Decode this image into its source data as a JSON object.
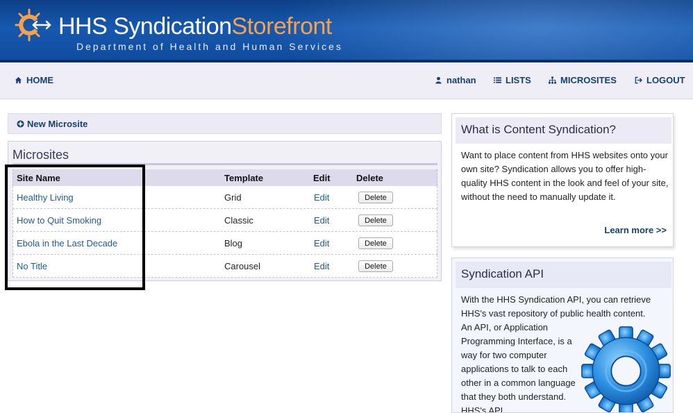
{
  "header": {
    "brand_hhs": "HHS",
    "brand_syndication": "Syndication",
    "brand_storefront": "Storefront",
    "subtitle": "Department of Health and Human Services"
  },
  "nav": {
    "home": "HOME",
    "user": "nathan",
    "lists": "LISTS",
    "microsites": "MICROSITES",
    "logout": "LOGOUT"
  },
  "new_microsite": "New Microsite",
  "microsites": {
    "title": "Microsites",
    "columns": [
      "Site Name",
      "Template",
      "Edit",
      "Delete"
    ],
    "rows": [
      {
        "site": "Healthy Living",
        "template": "Grid",
        "edit": "Edit",
        "delete": "Delete"
      },
      {
        "site": "How to Quit Smoking",
        "template": "Classic",
        "edit": "Edit",
        "delete": "Delete"
      },
      {
        "site": "Ebola in the Last Decade",
        "template": "Blog",
        "edit": "Edit",
        "delete": "Delete"
      },
      {
        "site": "No Title",
        "template": "Carousel",
        "edit": "Edit",
        "delete": "Delete"
      }
    ]
  },
  "syndication_box": {
    "title": "What is Content Syndication?",
    "body": "Want to place content from HHS websites onto your own site? Syndication allows you to offer high-quality HHS content in the look and feel of your site, without the need to manually update it.",
    "learn_more": "Learn more >>"
  },
  "api_box": {
    "title": "Syndication API",
    "body_full": "With the HHS Syndication API, you can retrieve HHS's vast repository of public health content.",
    "body_wrap": "An API, or Application Programming Interface, is a way for two computer applications to talk to each other in a common language that they both understand. HHS's API"
  },
  "colors": {
    "header_blue": "#1659b0",
    "brand_orange": "#f7a24a",
    "link_navy": "#16406e",
    "link_blue": "#1f5a97"
  },
  "icons": [
    "sun-logo-icon",
    "home-icon",
    "user-icon",
    "list-icon",
    "sitemap-icon",
    "logout-icon",
    "plus-circle-icon",
    "gear-icon"
  ]
}
